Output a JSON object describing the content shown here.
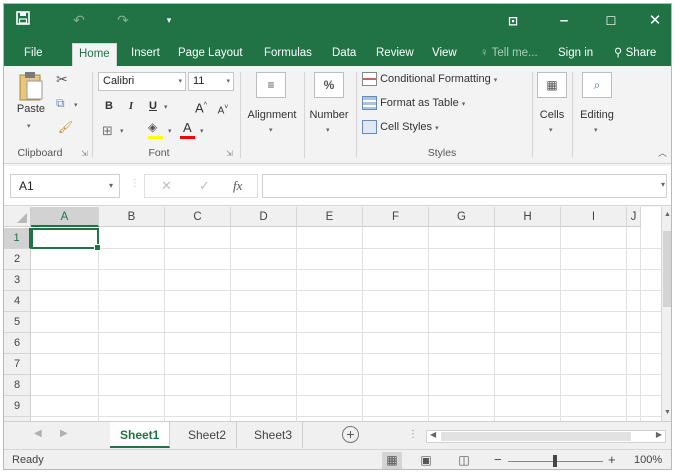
{
  "titlebar": {
    "save_icon": "save-icon",
    "undo_icon": "undo-icon",
    "redo_icon": "redo-icon",
    "customize_icon": "customize-icon",
    "ribbon_display_icon": "ribbon-display-icon",
    "minimize_icon": "minimize-icon",
    "maximize_icon": "maximize-icon",
    "close_icon": "close-icon"
  },
  "ribbon_tabs": {
    "file": "File",
    "home": "Home",
    "insert": "Insert",
    "page_layout": "Page Layout",
    "formulas": "Formulas",
    "data": "Data",
    "review": "Review",
    "view": "View",
    "tell_me": "Tell me...",
    "sign_in": "Sign in",
    "share": "Share",
    "active": "Home"
  },
  "ribbon": {
    "clipboard": {
      "label": "Clipboard",
      "paste": "Paste",
      "launcher": "⇲"
    },
    "font": {
      "label": "Font",
      "font_name": "Calibri",
      "font_size": "11",
      "bold": "B",
      "italic": "I",
      "underline": "U",
      "grow": "A",
      "shrink": "A",
      "font_color": "A",
      "launcher": "⇲"
    },
    "alignment": {
      "label": "Alignment"
    },
    "number": {
      "label": "Number",
      "icon_text": "%"
    },
    "styles": {
      "label": "Styles",
      "conditional_formatting": "Conditional Formatting",
      "format_as_table": "Format as Table",
      "cell_styles": "Cell Styles"
    },
    "cells": {
      "label": "Cells"
    },
    "editing": {
      "label": "Editing"
    }
  },
  "formula_bar": {
    "name_box": "A1",
    "cancel": "✕",
    "enter": "✓",
    "fx": "fx",
    "formula": ""
  },
  "grid": {
    "columns": [
      "A",
      "B",
      "C",
      "D",
      "E",
      "F",
      "G",
      "H",
      "I",
      "J"
    ],
    "rows": [
      "1",
      "2",
      "3",
      "4",
      "5",
      "6",
      "7",
      "8",
      "9"
    ],
    "selected_cell": "A1"
  },
  "sheets": {
    "tabs": [
      "Sheet1",
      "Sheet2",
      "Sheet3"
    ],
    "active": "Sheet1",
    "add_label": "+"
  },
  "statusbar": {
    "status": "Ready",
    "zoom_level": "100%",
    "zoom_minus": "−",
    "zoom_plus": "+"
  },
  "colors": {
    "accent": "#217346",
    "font_color_bar": "#ff0000",
    "highlight_bar": "#ffff00"
  }
}
